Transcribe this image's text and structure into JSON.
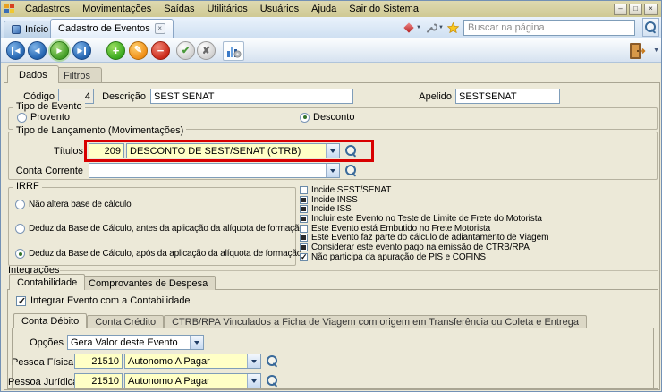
{
  "menubar": {
    "items": [
      "Cadastros",
      "Movimentações",
      "Saídas",
      "Utilitários",
      "Usuários",
      "Ajuda",
      "Sair do Sistema"
    ]
  },
  "window_controls": {
    "minimize": "–",
    "maximize": "□",
    "close": "×"
  },
  "doc_tabs": {
    "inicio": "Início",
    "active": "Cadastro de Eventos",
    "close": "×",
    "search_placeholder": "Buscar na página"
  },
  "page_tabs": {
    "dados": "Dados",
    "filtros": "Filtros"
  },
  "header_fields": {
    "codigo_label": "Código",
    "codigo_value": "4",
    "descricao_label": "Descrição",
    "descricao_value": "SEST SENAT",
    "apelido_label": "Apelido",
    "apelido_value": "SESTSENAT"
  },
  "tipo_evento": {
    "legend": "Tipo de Evento",
    "options": [
      {
        "label": "Provento",
        "selected": false
      },
      {
        "label": "Desconto",
        "selected": true
      }
    ]
  },
  "tipo_lancamento": {
    "legend": "Tipo de Lançamento (Movimentações)",
    "titulos_label": "Títulos",
    "titulos_code": "209",
    "titulos_value": "DESCONTO DE SEST/SENAT (CTRB)",
    "conta_corrente_label": "Conta Corrente",
    "conta_corrente_value": ""
  },
  "irrf": {
    "legend": "IRRF",
    "options": [
      {
        "label": "Não altera base de cálculo",
        "selected": false
      },
      {
        "label": "Deduz da Base de Cálculo, antes da aplicação da alíquota de formação",
        "selected": false
      },
      {
        "label": "Deduz da Base de Cálculo, após da aplicação da alíquota de formação",
        "selected": true
      }
    ]
  },
  "flags": [
    {
      "label": "Incide SEST/SENAT",
      "state": "unchecked"
    },
    {
      "label": "Incide INSS",
      "state": "filled"
    },
    {
      "label": "Incide ISS",
      "state": "filled"
    },
    {
      "label": "Incluir este Evento no Teste de Limite de Frete do Motorista",
      "state": "filled"
    },
    {
      "label": "Este Evento está Embutido no Frete Motorista",
      "state": "unchecked"
    },
    {
      "label": "Este Evento faz parte do cálculo de adiantamento de Viagem",
      "state": "filled"
    },
    {
      "label": "Considerar este evento pago na emissão de CTRB/RPA",
      "state": "filled"
    },
    {
      "label": "Não participa da apuração de PIS e COFINS",
      "state": "checked"
    }
  ],
  "integracoes": {
    "section_label": "Integrações",
    "tab_contabilidade": "Contabilidade",
    "tab_comprovantes": "Comprovantes de Despesa",
    "integrar_label": "Integrar Evento com a Contabilidade",
    "integrar_state": "checked",
    "subtab_debito": "Conta Débito",
    "subtab_credito": "Conta Crédito",
    "subtab_ctrb": "CTRB/RPA Vinculados a Ficha de Viagem com origem em Transferência ou Coleta e Entrega",
    "opcoes_label": "Opções",
    "opcoes_value": "Gera Valor deste Evento",
    "pf_label": "Pessoa Física",
    "pf_code": "21510",
    "pf_value": "Autonomo A Pagar",
    "pj_label": "Pessoa Jurídica",
    "pj_code": "21510",
    "pj_value": "Autonomo A Pagar"
  }
}
